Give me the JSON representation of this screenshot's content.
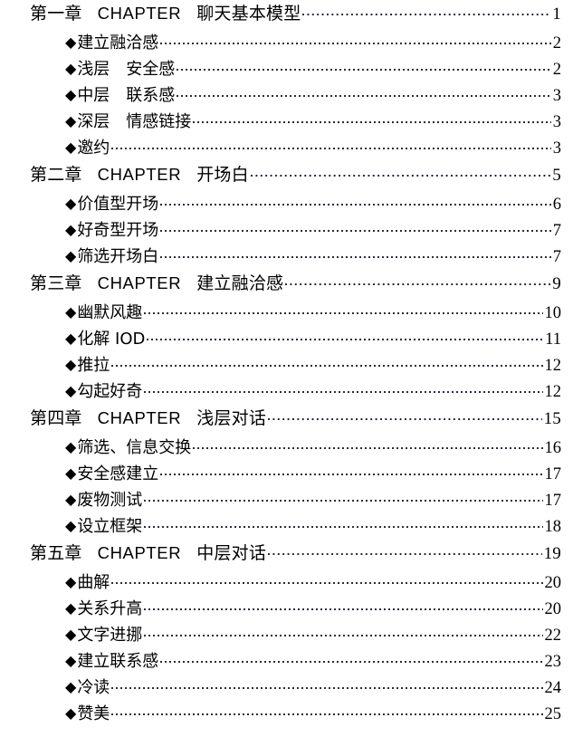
{
  "document": {
    "type": "table-of-contents",
    "chapter_marker": "CHAPTER",
    "bullet_glyph": "◆"
  },
  "entries": [
    {
      "level": "chapter",
      "number": "第一章",
      "marker": "CHAPTER",
      "title": "聊天基本模型",
      "page": "1"
    },
    {
      "level": "item",
      "bullet": "◆",
      "title": "建立融洽感",
      "page": "2"
    },
    {
      "level": "item",
      "bullet": "◆",
      "title": "浅层　安全感",
      "page": "2"
    },
    {
      "level": "item",
      "bullet": "◆",
      "title": "中层　联系感",
      "page": "3"
    },
    {
      "level": "item",
      "bullet": "◆",
      "title": "深层　情感链接",
      "page": "3"
    },
    {
      "level": "item",
      "bullet": "◆",
      "title": "邀约",
      "page": "3"
    },
    {
      "level": "chapter",
      "number": "第二章",
      "marker": "CHAPTER",
      "title": "开场白",
      "page": "5"
    },
    {
      "level": "item",
      "bullet": "◆",
      "title": "价值型开场",
      "page": "6"
    },
    {
      "level": "item",
      "bullet": "◆",
      "title": "好奇型开场",
      "page": "7"
    },
    {
      "level": "item",
      "bullet": "◆",
      "title": "筛选开场白",
      "page": "7"
    },
    {
      "level": "chapter",
      "number": "第三章",
      "marker": "CHAPTER",
      "title": "建立融洽感",
      "page": "9"
    },
    {
      "level": "item",
      "bullet": "◆",
      "title": "幽默风趣",
      "page": "10"
    },
    {
      "level": "item",
      "bullet": "◆",
      "title": "化解 IOD",
      "page": "11"
    },
    {
      "level": "item",
      "bullet": "◆",
      "title": "推拉",
      "page": "12"
    },
    {
      "level": "item",
      "bullet": "◆",
      "title": "勾起好奇",
      "page": "12"
    },
    {
      "level": "chapter",
      "number": "第四章",
      "marker": "CHAPTER",
      "title": "浅层对话",
      "page": "15"
    },
    {
      "level": "item",
      "bullet": "◆",
      "title": "筛选、信息交换",
      "page": "16"
    },
    {
      "level": "item",
      "bullet": "◆",
      "title": "安全感建立",
      "page": "17"
    },
    {
      "level": "item",
      "bullet": "◆",
      "title": "废物测试",
      "page": "17"
    },
    {
      "level": "item",
      "bullet": "◆",
      "title": "设立框架",
      "page": "18"
    },
    {
      "level": "chapter",
      "number": "第五章",
      "marker": "CHAPTER",
      "title": "中层对话",
      "page": "19"
    },
    {
      "level": "item",
      "bullet": "◆",
      "title": "曲解",
      "page": "20"
    },
    {
      "level": "item",
      "bullet": "◆",
      "title": "关系升高",
      "page": "20"
    },
    {
      "level": "item",
      "bullet": "◆",
      "title": "文字进挪",
      "page": "22"
    },
    {
      "level": "item",
      "bullet": "◆",
      "title": "建立联系感",
      "page": "23"
    },
    {
      "level": "item",
      "bullet": "◆",
      "title": "冷读",
      "page": "24"
    },
    {
      "level": "item",
      "bullet": "◆",
      "title": "赞美",
      "page": "25"
    }
  ]
}
